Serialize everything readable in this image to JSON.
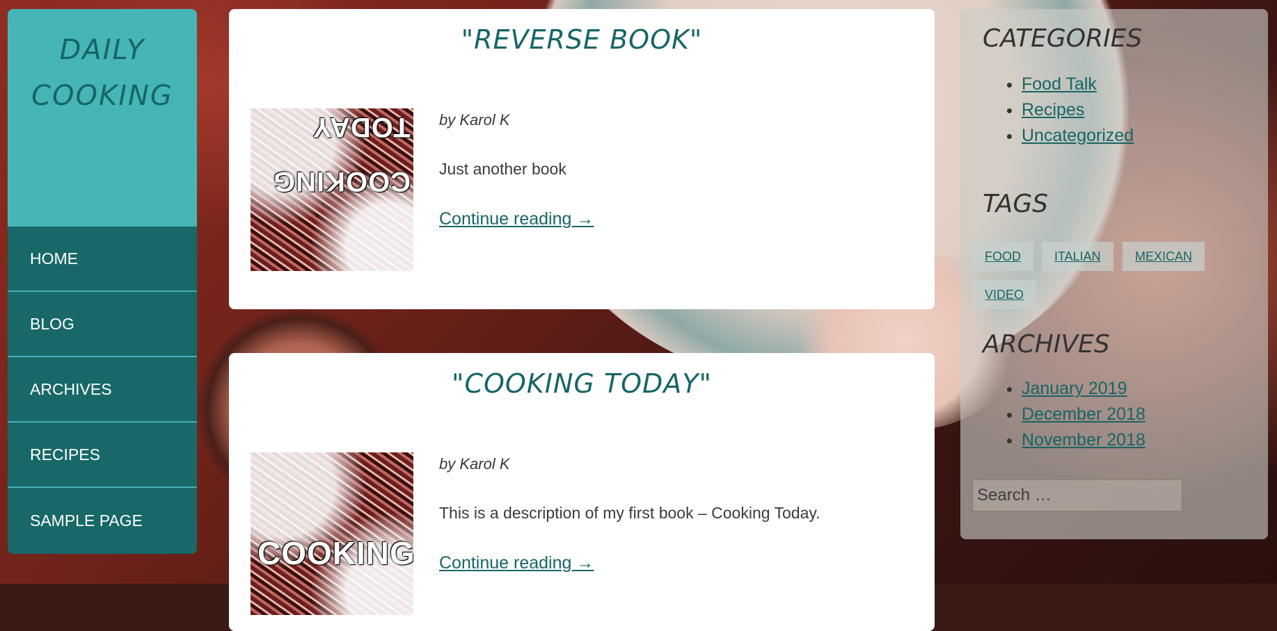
{
  "site": {
    "title_line1": "DAILY",
    "title_line2": "COOKING"
  },
  "nav": {
    "items": [
      {
        "label": "HOME"
      },
      {
        "label": "BLOG"
      },
      {
        "label": "ARCHIVES"
      },
      {
        "label": "RECIPES"
      },
      {
        "label": "SAMPLE PAGE"
      }
    ]
  },
  "posts": [
    {
      "title": "\"REVERSE BOOK\"",
      "byline": "by Karol K",
      "excerpt": "Just another book",
      "more": "Continue reading →",
      "thumb_text_a": "TODAY",
      "thumb_text_b": "COOKING"
    },
    {
      "title": "\"COOKING TODAY\"",
      "byline": "by Karol K",
      "excerpt": "This is a description of my first book – Cooking Today.",
      "more": "Continue reading →",
      "thumb_text_a": "COOKING"
    }
  ],
  "sidebar": {
    "categories_heading": "CATEGORIES",
    "categories": [
      "Food Talk",
      "Recipes",
      "Uncategorized"
    ],
    "tags_heading": "TAGS",
    "tags": [
      "FOOD",
      "ITALIAN",
      "MEXICAN",
      "VIDEO"
    ],
    "archives_heading": "ARCHIVES",
    "archives": [
      "January 2019",
      "December 2018",
      "November 2018"
    ],
    "search_placeholder": "Search …"
  },
  "colors": {
    "accent_teal": "#46b5b6",
    "nav_dark_teal": "#186868",
    "link_teal": "#176566"
  }
}
